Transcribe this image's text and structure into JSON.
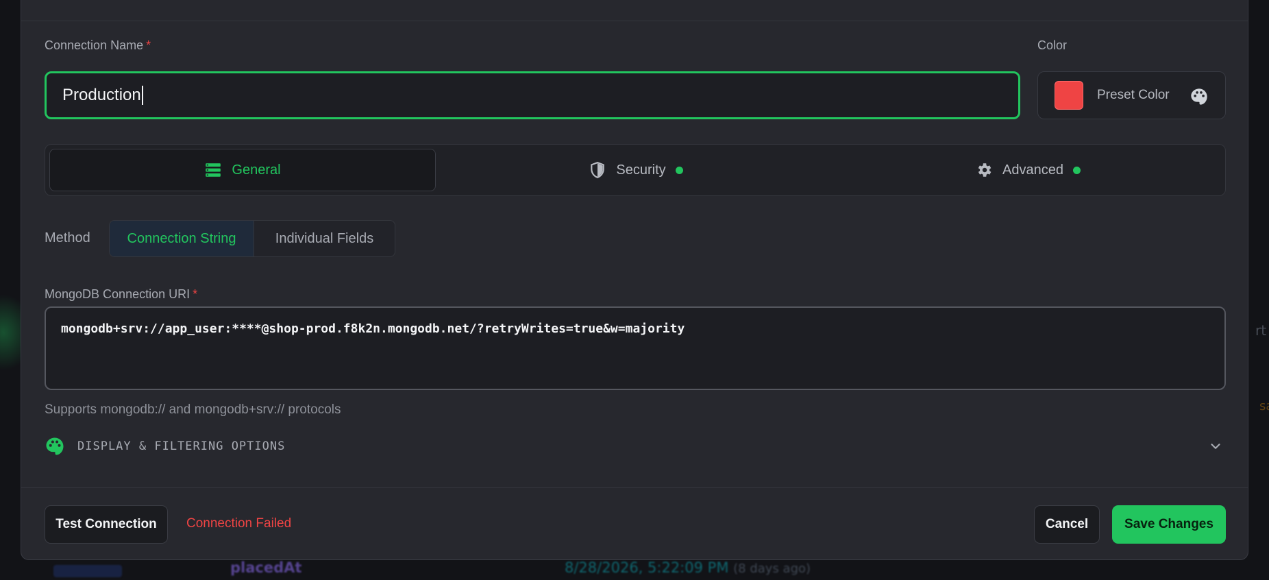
{
  "background": {
    "right_glyph_1": "rt",
    "right_glyph_2": "sa",
    "field_name": "placedAt",
    "date_value": "8/28/2026, 5:22:09 PM",
    "date_relative": "(8 days ago)"
  },
  "form": {
    "connection_name_label": "Connection Name",
    "required_mark": "*",
    "connection_name_value": "Production",
    "color_label": "Color",
    "color_value": "#ef4444",
    "preset_color_label": "Preset Color",
    "palette_icon": "palette-icon"
  },
  "tabs": [
    {
      "label": "General",
      "icon": "server-list-icon",
      "active": true
    },
    {
      "label": "Security",
      "icon": "shield-icon",
      "dot": true
    },
    {
      "label": "Advanced",
      "icon": "gear-icon",
      "dot": true
    }
  ],
  "method": {
    "label": "Method",
    "options": [
      "Connection String",
      "Individual Fields"
    ],
    "selected": "Connection String"
  },
  "uri": {
    "label": "MongoDB Connection URI",
    "value": "mongodb+srv://app_user:****@shop-prod.f8k2n.mongodb.net/?retryWrites=true&w=majority",
    "helper": "Supports mongodb:// and mongodb+srv:// protocols"
  },
  "display_options": {
    "label": "DISPLAY & FILTERING OPTIONS",
    "icon": "palette-icon",
    "toggle_icon": "chevron-down-icon"
  },
  "footer": {
    "test_label": "Test Connection",
    "status": "Connection Failed",
    "cancel_label": "Cancel",
    "save_label": "Save Changes"
  },
  "colors": {
    "accent": "#22c55e",
    "error": "#ef4444",
    "surface": "#27282e"
  }
}
